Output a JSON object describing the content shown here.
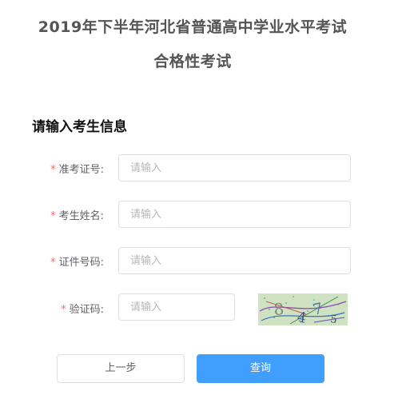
{
  "header": {
    "title_line1": "2019年下半年河北省普通高中学业水平考试",
    "title_line2": "合格性考试"
  },
  "section_title": "请输入考生信息",
  "form": {
    "required_mark": "*",
    "fields": [
      {
        "label": "准考证号:",
        "placeholder": "请输入"
      },
      {
        "label": "考生姓名:",
        "placeholder": "请输入"
      },
      {
        "label": "证件号码:",
        "placeholder": "请输入"
      },
      {
        "label": "验证码:",
        "placeholder": "请输入"
      }
    ],
    "captcha": {
      "text": "8475",
      "bg_color": "#cfe3c3"
    }
  },
  "buttons": {
    "prev": "上一步",
    "query": "查询"
  },
  "colors": {
    "primary": "#409eff",
    "required": "#f56c6c",
    "border": "#dcdfe6"
  }
}
